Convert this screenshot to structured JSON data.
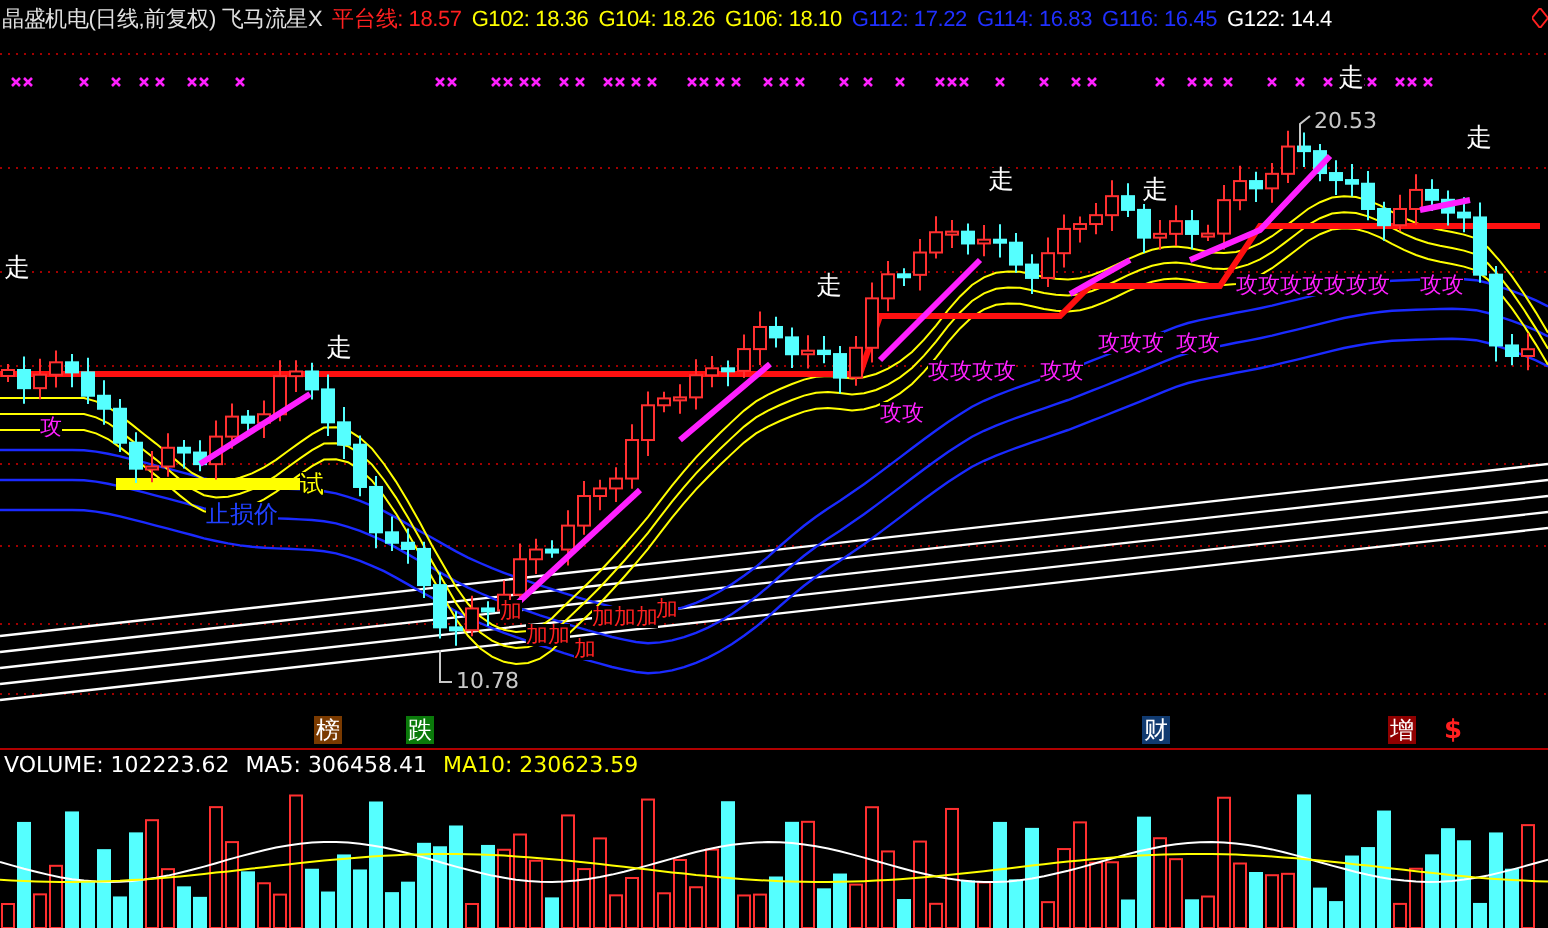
{
  "title": "晶盛机电(日线,前复权) 飞马流星X",
  "legend": [
    {
      "text": "平台线: 18.57",
      "color": "#ff2020"
    },
    {
      "text": "G102: 18.36",
      "color": "#ffff00"
    },
    {
      "text": "G104: 18.26",
      "color": "#ffff00"
    },
    {
      "text": "G106: 18.10",
      "color": "#ffff00"
    },
    {
      "text": "G112: 17.22",
      "color": "#2030ff"
    },
    {
      "text": "G114: 16.83",
      "color": "#2030ff"
    },
    {
      "text": "G116: 16.45",
      "color": "#2030ff"
    },
    {
      "text": "G122: 14.4",
      "color": "#ffffff"
    }
  ],
  "annotations": [
    {
      "text": "走",
      "kind": "exit"
    },
    {
      "text": "走",
      "kind": "exit"
    },
    {
      "text": "走",
      "kind": "exit"
    },
    {
      "text": "走",
      "kind": "exit"
    },
    {
      "text": "走",
      "kind": "exit"
    },
    {
      "text": "走",
      "kind": "exit"
    },
    {
      "text": "走",
      "kind": "exit"
    },
    {
      "text": "20.53",
      "kind": "price"
    },
    {
      "text": "10.78",
      "kind": "price"
    },
    {
      "text": "止损价",
      "kind": "stop"
    },
    {
      "text": "试",
      "kind": "trial"
    },
    {
      "text": "攻",
      "kind": "attack"
    },
    {
      "text": "攻攻",
      "kind": "attack"
    },
    {
      "text": "攻攻攻攻",
      "kind": "attack"
    },
    {
      "text": "攻攻",
      "kind": "attack"
    },
    {
      "text": "攻攻攻",
      "kind": "attack"
    },
    {
      "text": "攻攻",
      "kind": "attack"
    },
    {
      "text": "攻攻攻攻攻攻攻",
      "kind": "attack"
    },
    {
      "text": "攻攻",
      "kind": "attack"
    },
    {
      "text": "加",
      "kind": "add"
    },
    {
      "text": "加加",
      "kind": "add"
    },
    {
      "text": "加",
      "kind": "add"
    },
    {
      "text": "加加加",
      "kind": "add"
    },
    {
      "text": "加",
      "kind": "add"
    }
  ],
  "events": [
    {
      "text": "榜",
      "kind": "badge",
      "color": "#7a3a00"
    },
    {
      "text": "跌",
      "kind": "badge",
      "color": "#0a7a0a"
    },
    {
      "text": "财",
      "kind": "badge",
      "color": "#103a70"
    },
    {
      "text": "增",
      "kind": "badge",
      "color": "#900000"
    },
    {
      "text": "$",
      "kind": "mark",
      "color": "#ff2020"
    }
  ],
  "volume_legend": [
    {
      "text": "VOLUME: 102223.62",
      "color": "#ffffff"
    },
    {
      "text": "MA5: 306458.41",
      "color": "#ffffff"
    },
    {
      "text": "MA10: 230623.59",
      "color": "#ffff00"
    }
  ]
}
